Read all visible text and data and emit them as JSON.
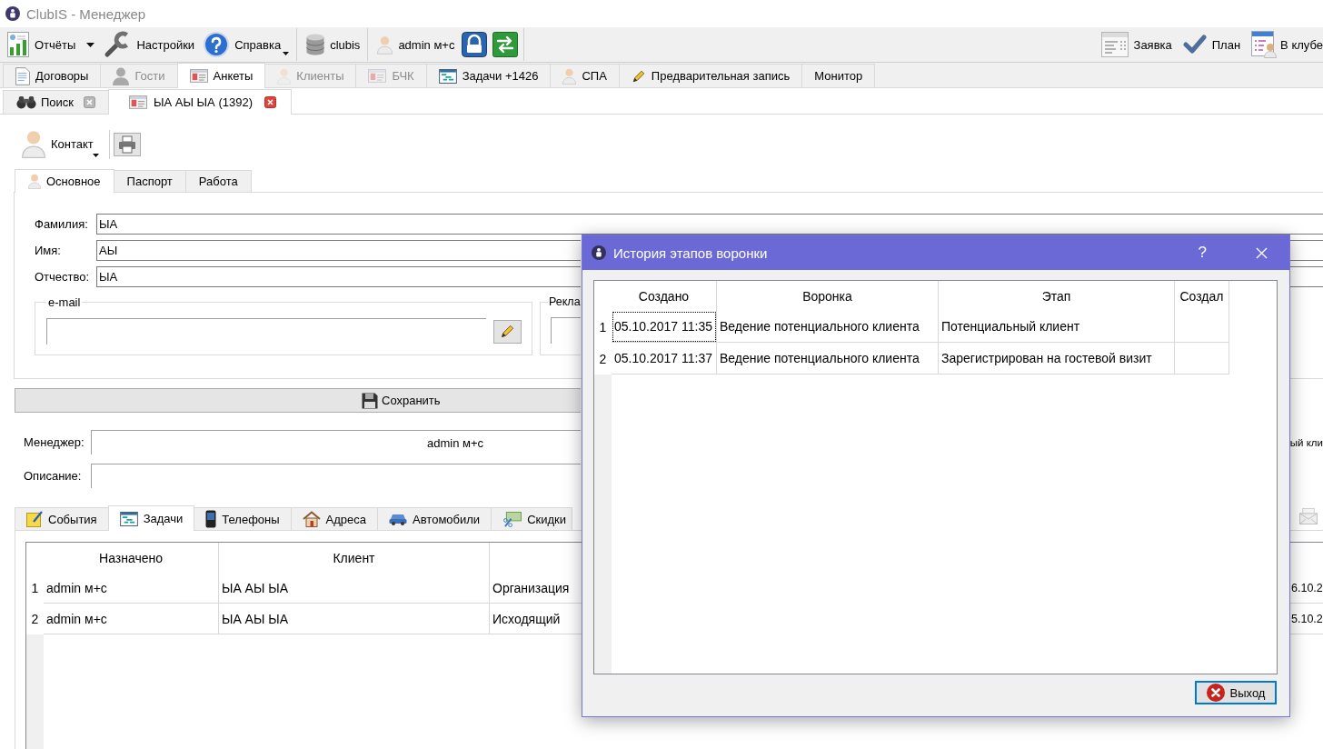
{
  "window": {
    "title": "ClubIS - Менеджер"
  },
  "toolbar": {
    "groups": [
      [
        {
          "kind": "menu",
          "label": "Отчёты"
        },
        {
          "kind": "plain",
          "label": "Настройки"
        },
        {
          "kind": "split",
          "label": "Справка"
        }
      ],
      [
        {
          "kind": "plain",
          "label": "clubis"
        }
      ],
      [
        {
          "kind": "plain",
          "label": "admin м+с"
        },
        {
          "kind": "icon"
        },
        {
          "kind": "icon"
        }
      ]
    ],
    "right": [
      {
        "label": "Заявка"
      },
      {
        "label": "План"
      },
      {
        "label": "В клубе"
      }
    ]
  },
  "main_tabs": [
    {
      "label": "Договоры",
      "selected": false,
      "disabled": false
    },
    {
      "label": "Гости",
      "selected": false,
      "disabled": true
    },
    {
      "label": "Анкеты",
      "selected": true,
      "disabled": false
    },
    {
      "label": "Клиенты",
      "selected": false,
      "disabled": true
    },
    {
      "label": "БЧК",
      "selected": false,
      "disabled": true
    },
    {
      "label": "Задачи +1426",
      "selected": false,
      "disabled": false
    },
    {
      "label": "СПА",
      "selected": false,
      "disabled": false
    },
    {
      "label": "Предварительная запись",
      "selected": false,
      "disabled": false
    },
    {
      "label": "Монитор",
      "selected": false,
      "disabled": false
    }
  ],
  "doc_tabs": [
    {
      "label": "Поиск",
      "selected": false
    },
    {
      "label": "ЫА АЫ ЫА (1392)",
      "selected": true
    }
  ],
  "contact_button": "Контакт",
  "form_tabs": [
    {
      "label": "Основное",
      "selected": true
    },
    {
      "label": "Паспорт",
      "selected": false
    },
    {
      "label": "Работа",
      "selected": false
    }
  ],
  "fields": [
    {
      "label": "Фамилия:",
      "value": "ЫА"
    },
    {
      "label": "Имя:",
      "value": "АЫ"
    },
    {
      "label": "Отчество:",
      "value": "ЫА"
    }
  ],
  "email_group": {
    "title": "e-mail"
  },
  "ad_group": {
    "title": "Рекла"
  },
  "save_button": "Сохранить",
  "manager": {
    "label": "Менеджер:",
    "value": "admin м+с",
    "text_right": "ый кли"
  },
  "description": {
    "label": "Описание:"
  },
  "lower_tabs": [
    {
      "label": "События",
      "selected": false
    },
    {
      "label": "Задачи",
      "selected": true
    },
    {
      "label": "Телефоны",
      "selected": false
    },
    {
      "label": "Адреса",
      "selected": false
    },
    {
      "label": "Автомобили",
      "selected": false
    },
    {
      "label": "Скидки",
      "selected": false
    }
  ],
  "tasks_table": {
    "columns": [
      "Назначено",
      "Клиент"
    ],
    "rows": [
      {
        "number": "1",
        "cells": [
          "admin м+с",
          "ЫА АЫ ЫА",
          "Организация",
          "6.10.2"
        ]
      },
      {
        "number": "2",
        "cells": [
          "admin м+с",
          "ЫА АЫ ЫА",
          "Исходящий",
          "5.10.2"
        ]
      }
    ]
  },
  "dialog": {
    "title": "История этапов воронки",
    "help_button": "?",
    "table": {
      "columns": [
        "Создано",
        "Воронка",
        "Этап",
        "Создал"
      ],
      "rows": [
        {
          "number": "1",
          "cells": [
            "05.10.2017 11:35",
            "Ведение потенциального клиента",
            "Потенциальный клиент"
          ],
          "focused": true
        },
        {
          "number": "2",
          "cells": [
            "05.10.2017 11:37",
            "Ведение потенциального клиента",
            "Зарегистрирован на гостевой визит"
          ],
          "focused": false
        }
      ]
    },
    "exit_button": "Выход"
  }
}
